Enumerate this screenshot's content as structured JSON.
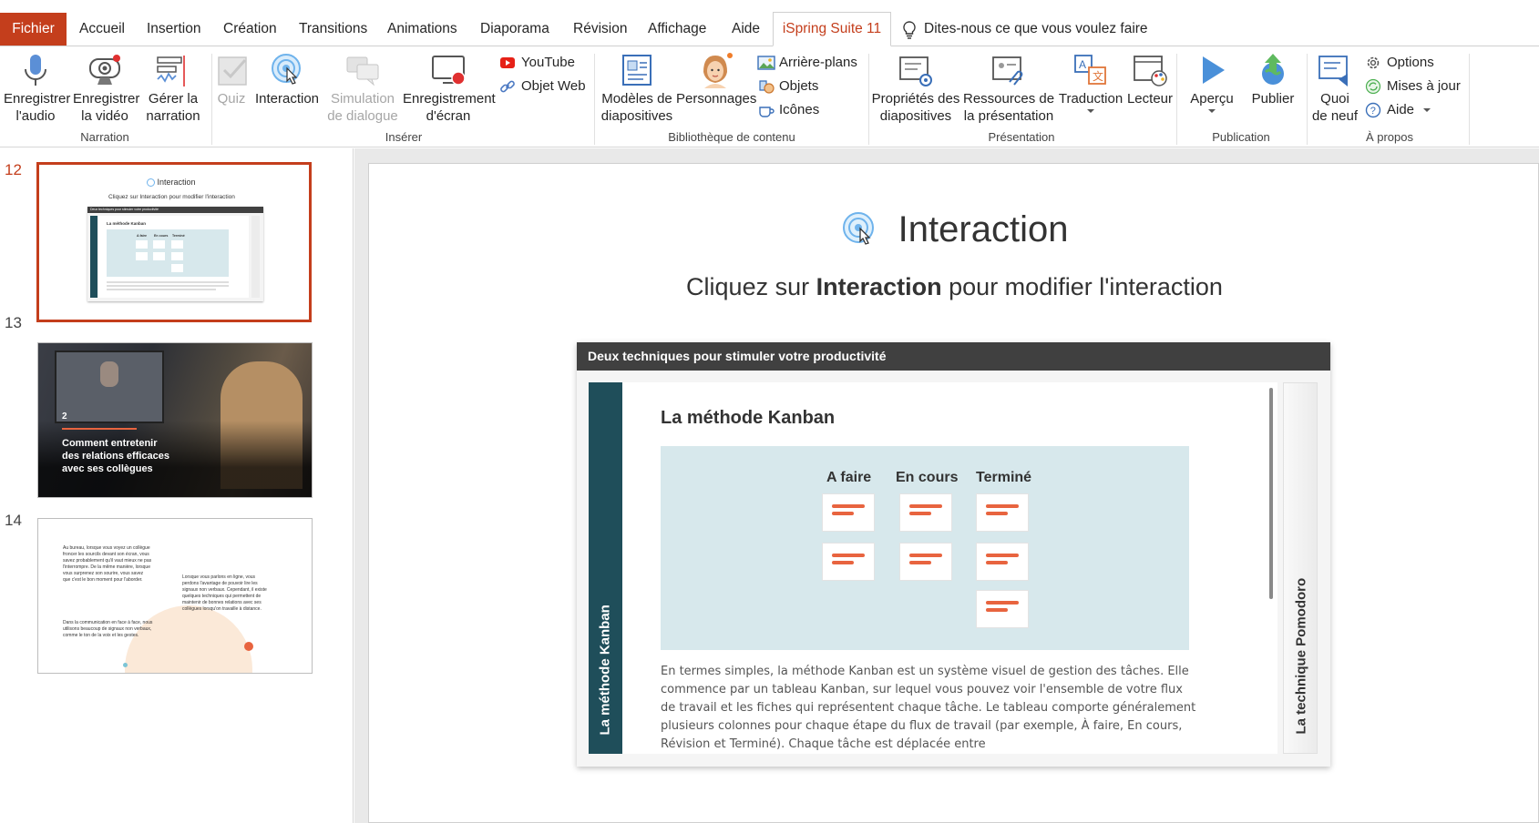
{
  "tabs": {
    "file": "Fichier",
    "items": [
      "Accueil",
      "Insertion",
      "Création",
      "Transitions",
      "Animations",
      "Diaporama",
      "Révision",
      "Affichage",
      "Aide"
    ],
    "active": "iSpring Suite 11",
    "tell_me": "Dites-nous ce que vous voulez faire"
  },
  "ribbon": {
    "narration": {
      "label": "Narration",
      "record_audio": [
        "Enregistrer",
        "l'audio"
      ],
      "record_video": [
        "Enregistrer",
        "la vidéo"
      ],
      "manage": [
        "Gérer la",
        "narration"
      ]
    },
    "insert": {
      "label": "Insérer",
      "quiz": "Quiz",
      "interaction": "Interaction",
      "dialog": [
        "Simulation",
        "de dialogue"
      ],
      "screen": [
        "Enregistrement",
        "d'écran"
      ],
      "youtube": "YouTube",
      "web_object": "Objet Web"
    },
    "library": {
      "label": "Bibliothèque de contenu",
      "templates": [
        "Modèles de",
        "diapositives"
      ],
      "characters": "Personnages",
      "backgrounds": "Arrière-plans",
      "objects": "Objets",
      "icons": "Icônes"
    },
    "presentation": {
      "label": "Présentation",
      "properties": [
        "Propriétés des",
        "diapositives"
      ],
      "resources": [
        "Ressources de",
        "la présentation"
      ],
      "translation": "Traduction",
      "player": "Lecteur"
    },
    "publication": {
      "label": "Publication",
      "preview": "Aperçu",
      "publish": "Publier"
    },
    "about": {
      "label": "À propos",
      "whats_new": [
        "Quoi",
        "de neuf"
      ],
      "options": "Options",
      "updates": "Mises à jour",
      "help": "Aide"
    }
  },
  "slides": {
    "numbers": [
      "12",
      "13",
      "14"
    ],
    "thumb12": {
      "title": "Interaction",
      "sub": "Cliquez sur Interaction pour modifier l'interaction",
      "head": "Deux techniques pour stimuler votre productivité",
      "kanban": "La méthode Kanban",
      "cols": [
        "A faire",
        "En cours",
        "Terminé"
      ],
      "left": "La méthode Kanban",
      "right": "La technique Pomodoro"
    },
    "thumb13": {
      "num": "2",
      "title": [
        "Comment entretenir",
        "des relations efficaces",
        "avec ses collègues"
      ]
    },
    "thumb14": {
      "p1": [
        "Au bureau, lorsque vous voyez un collègue",
        "froncer les sourcils devant son écran, vous",
        "savez probablement qu'il vaut mieux ne pas",
        "l'interrompre. De la même manière, lorsque",
        "vous surprenez son sourire, vous savez",
        "que c'est le bon moment pour l'aborder."
      ],
      "p2": [
        "Lorsque vous parlons en ligne, vous",
        "perdons l'avantage de pouvoir lire les",
        "signaux non verbaux. Cependant, il existe",
        "quelques techniques qui permettent de",
        "maintenir de bonnes relations avec ses",
        "collègues lorsqu'on travaille à distance."
      ],
      "p3": [
        "Dans la communication en face à face, nous",
        "utilisons beaucoup de signaux non verbaux,",
        "comme le ton de la voix et les gestes."
      ]
    }
  },
  "slide": {
    "title": "Interaction",
    "subtitle_pre": "Cliquez sur ",
    "subtitle_bold": "Interaction",
    "subtitle_post": " pour modifier l'interaction",
    "card": {
      "header": "Deux techniques pour stimuler votre productivité",
      "left_tab": "La méthode Kanban",
      "right_tab": "La technique Pomodoro",
      "kanban_title": "La méthode Kanban",
      "columns": [
        "A faire",
        "En cours",
        "Terminé"
      ],
      "body": "En termes simples, la méthode Kanban est un système visuel de gestion des tâches. Elle commence par un tableau Kanban, sur lequel vous pouvez voir l'ensemble de votre flux de travail et les fiches qui représentent chaque tâche. Le tableau comporte généralement plusieurs colonnes pour chaque étape du flux de travail (par exemple, À faire, En cours, Révision et Terminé). Chaque tâche est déplacée entre"
    }
  }
}
